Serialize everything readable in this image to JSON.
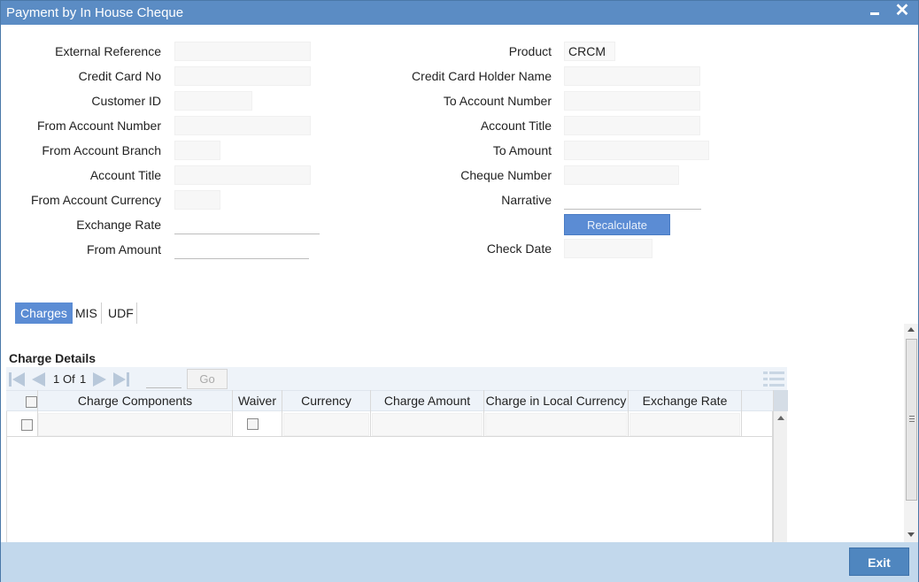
{
  "window": {
    "title": "Payment by In House Cheque",
    "minimize_icon": "minimize-icon",
    "close_icon": "close-icon",
    "close_glyph": "✕"
  },
  "form_left": {
    "external_reference": {
      "label": "External Reference",
      "value": ""
    },
    "credit_card_no": {
      "label": "Credit Card No",
      "value": ""
    },
    "customer_id": {
      "label": "Customer ID",
      "value": ""
    },
    "from_account_number": {
      "label": "From Account Number",
      "value": ""
    },
    "from_account_branch": {
      "label": "From Account Branch",
      "value": ""
    },
    "account_title": {
      "label": "Account Title",
      "value": ""
    },
    "from_account_currency": {
      "label": "From Account Currency",
      "value": ""
    },
    "exchange_rate": {
      "label": "Exchange Rate",
      "value": ""
    },
    "from_amount": {
      "label": "From Amount",
      "value": ""
    }
  },
  "form_right": {
    "product": {
      "label": "Product",
      "value": "CRCM"
    },
    "credit_card_holder_name": {
      "label": "Credit Card Holder Name",
      "value": ""
    },
    "to_account_number": {
      "label": "To Account Number",
      "value": ""
    },
    "account_title": {
      "label": "Account Title",
      "value": ""
    },
    "to_amount": {
      "label": "To Amount",
      "value": ""
    },
    "cheque_number": {
      "label": "Cheque Number",
      "value": ""
    },
    "narrative": {
      "label": "Narrative",
      "value": ""
    },
    "recalculate_label": "Recalculate",
    "check_date": {
      "label": "Check Date",
      "value": ""
    }
  },
  "tabs": [
    {
      "label": "Charges",
      "active": true
    },
    {
      "label": "MIS",
      "active": false
    },
    {
      "label": "UDF",
      "active": false
    }
  ],
  "charges": {
    "section_title": "Charge Details",
    "pagination": {
      "current": "1",
      "of_label": "Of",
      "total": "1",
      "go_label": "Go"
    },
    "columns": [
      "Charge Components",
      "Waiver",
      "Currency",
      "Charge Amount",
      "Charge in Local Currency",
      "Exchange Rate"
    ],
    "rows": [
      {
        "charge_components": "",
        "waiver": false,
        "currency": "",
        "charge_amount": "",
        "charge_local": "",
        "exchange_rate": ""
      }
    ]
  },
  "footer": {
    "exit_label": "Exit"
  },
  "colors": {
    "titlebar": "#5b8cc4",
    "accent": "#5b8cd4",
    "footer": "#c2d8ec"
  }
}
